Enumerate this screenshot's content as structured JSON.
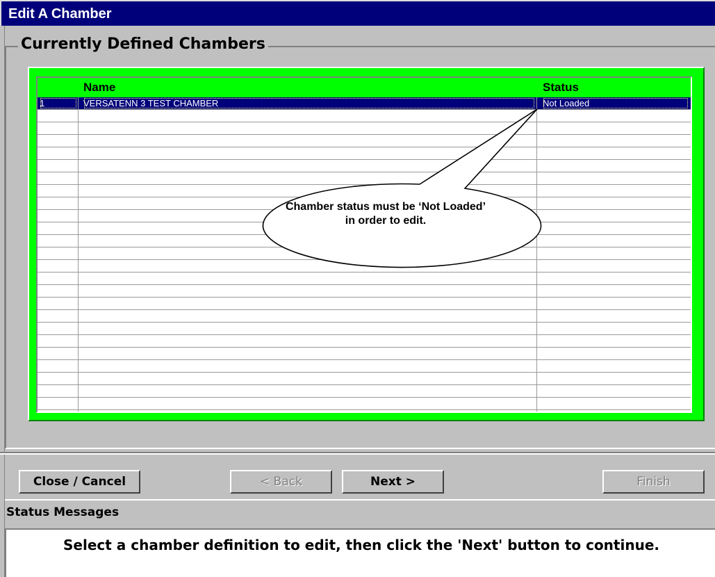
{
  "window": {
    "title": "Edit A Chamber"
  },
  "group": {
    "label": "Currently Defined Chambers"
  },
  "grid": {
    "headers": {
      "name": "Name",
      "status": "Status"
    },
    "rows": [
      {
        "num": "1",
        "name": "VERSATENN 3 TEST CHAMBER",
        "status": "Not Loaded",
        "selected": true
      },
      {
        "num": "",
        "name": "",
        "status": ""
      },
      {
        "num": "",
        "name": "",
        "status": ""
      },
      {
        "num": "",
        "name": "",
        "status": ""
      },
      {
        "num": "",
        "name": "",
        "status": ""
      },
      {
        "num": "",
        "name": "",
        "status": ""
      },
      {
        "num": "",
        "name": "",
        "status": ""
      },
      {
        "num": "",
        "name": "",
        "status": ""
      },
      {
        "num": "",
        "name": "",
        "status": ""
      },
      {
        "num": "",
        "name": "",
        "status": ""
      },
      {
        "num": "",
        "name": "",
        "status": ""
      },
      {
        "num": "",
        "name": "",
        "status": ""
      },
      {
        "num": "",
        "name": "",
        "status": ""
      },
      {
        "num": "",
        "name": "",
        "status": ""
      },
      {
        "num": "",
        "name": "",
        "status": ""
      },
      {
        "num": "",
        "name": "",
        "status": ""
      },
      {
        "num": "",
        "name": "",
        "status": ""
      },
      {
        "num": "",
        "name": "",
        "status": ""
      },
      {
        "num": "",
        "name": "",
        "status": ""
      },
      {
        "num": "",
        "name": "",
        "status": ""
      },
      {
        "num": "",
        "name": "",
        "status": ""
      },
      {
        "num": "",
        "name": "",
        "status": ""
      },
      {
        "num": "",
        "name": "",
        "status": ""
      },
      {
        "num": "",
        "name": "",
        "status": ""
      },
      {
        "num": "",
        "name": "",
        "status": ""
      }
    ]
  },
  "callout": {
    "text": "Chamber status must be ‘Not Loaded’ in order to edit."
  },
  "buttons": {
    "close": "Close / Cancel",
    "back": "< Back",
    "next": "Next >",
    "finish": "Finish"
  },
  "status": {
    "heading": "Status Messages",
    "message": "Select a chamber definition to edit, then click the 'Next' button to continue."
  },
  "colors": {
    "titlebar": "#00007b",
    "grid_frame": "#00ff00",
    "selection": "#00007b",
    "face": "#c0c0c0"
  }
}
